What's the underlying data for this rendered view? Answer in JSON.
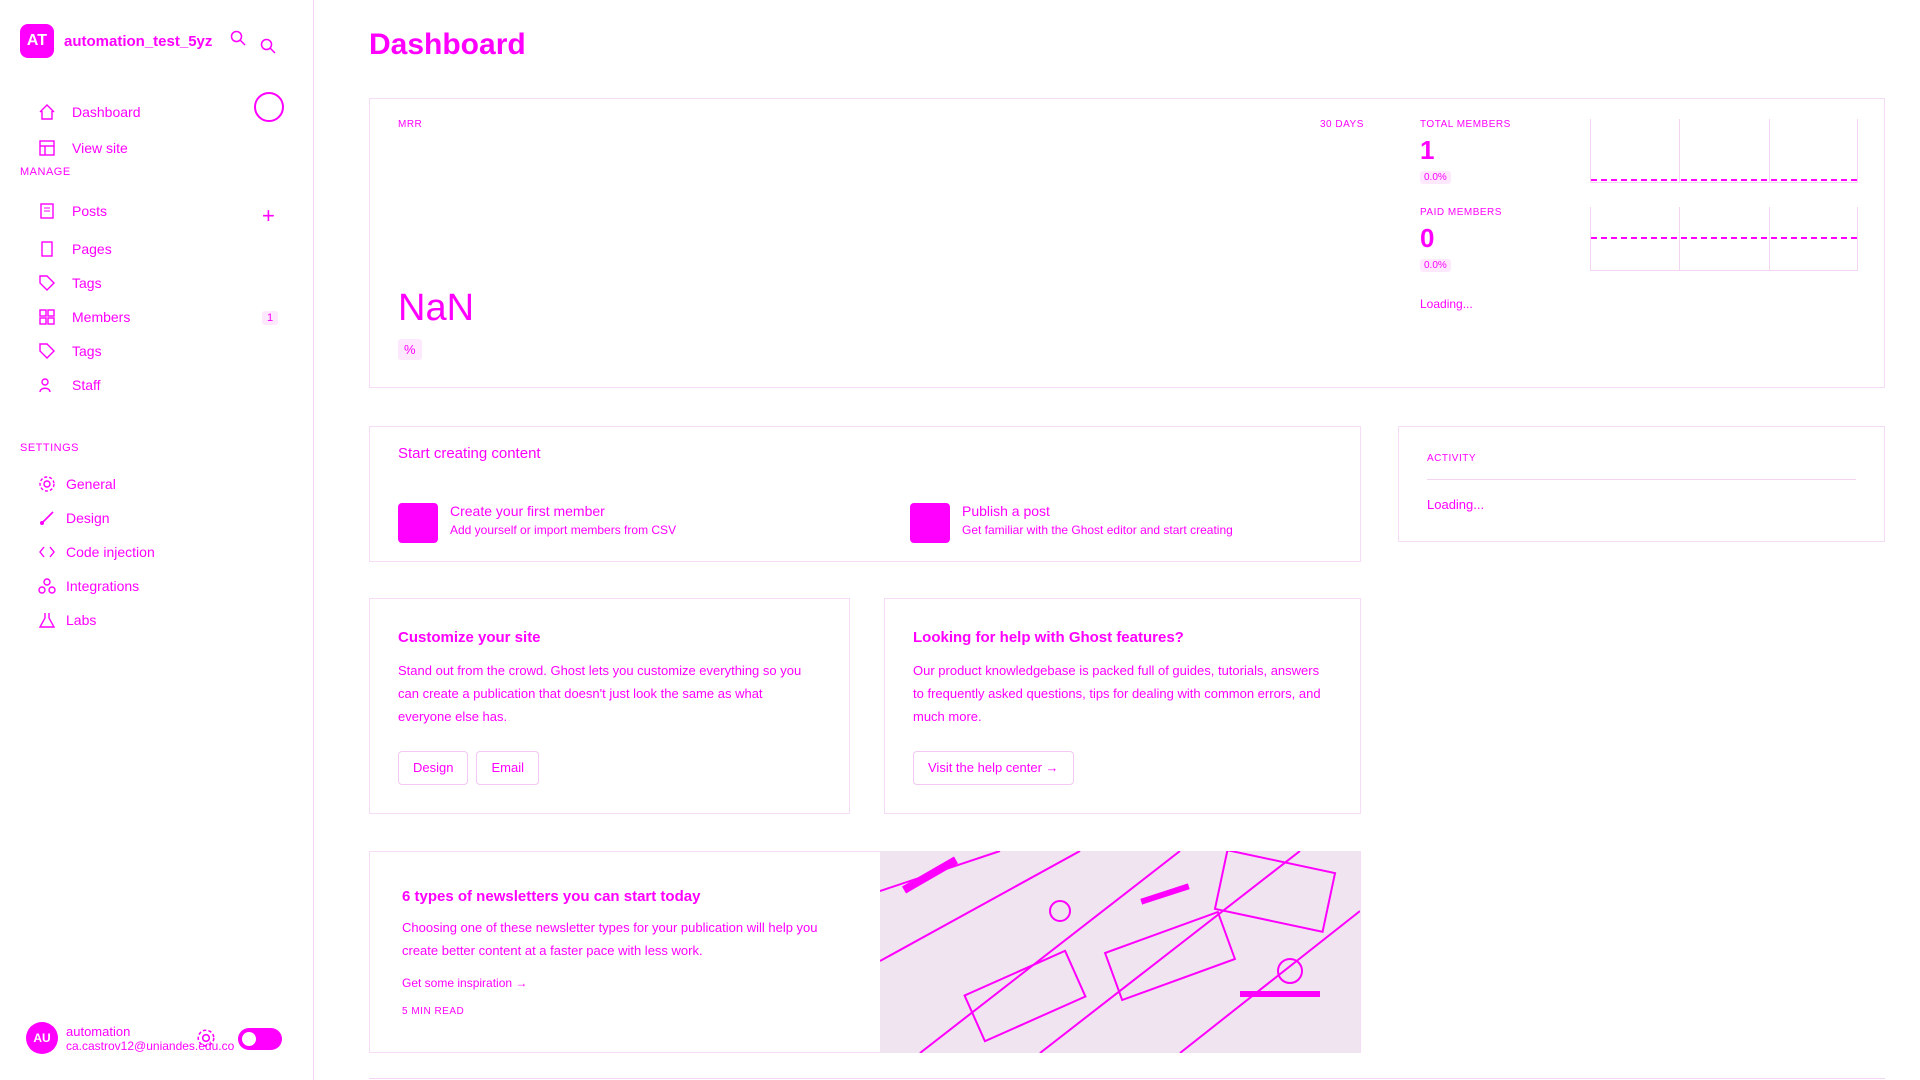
{
  "brand": {
    "name": "automation_test_5yz",
    "initials": "AT"
  },
  "sidebar": {
    "top_items": [
      {
        "label": "Dashboard",
        "icon": "home-icon"
      },
      {
        "label": "View site",
        "icon": "layout-icon"
      }
    ],
    "manage_label": "MANAGE",
    "manage_items": [
      {
        "label": "Posts",
        "icon": "posts-icon"
      },
      {
        "label": "Pages",
        "icon": "pages-icon"
      },
      {
        "label": "Tags",
        "icon": "tag-icon"
      },
      {
        "label": "Members",
        "icon": "members-icon",
        "count": "1"
      },
      {
        "label": "Tags",
        "icon": "tag-icon"
      },
      {
        "label": "Staff",
        "icon": "staff-icon"
      }
    ],
    "settings_label": "SETTINGS",
    "settings_items": [
      {
        "label": "General",
        "icon": "gear-icon"
      },
      {
        "label": "Design",
        "icon": "brush-icon"
      },
      {
        "label": "Code injection",
        "icon": "code-icon"
      },
      {
        "label": "Integrations",
        "icon": "integrations-icon"
      },
      {
        "label": "Labs",
        "icon": "flask-icon"
      }
    ],
    "user": {
      "name": "automation",
      "email": "ca.castrov12@uniandes.edu.co",
      "initials": "AU"
    }
  },
  "main": {
    "title": "Dashboard",
    "mrr": {
      "label": "MRR",
      "range": "30 DAYS",
      "value": "NaN",
      "pct": "%"
    },
    "total_members": {
      "label": "TOTAL MEMBERS",
      "value": "1",
      "pct": "0.0%"
    },
    "paid_members": {
      "label": "PAID MEMBERS",
      "value": "0",
      "pct": "0.0%"
    },
    "members_loading": "Loading...",
    "start_card": {
      "title": "Start creating content",
      "features": [
        {
          "title": "Create your first member",
          "sub": "Add yourself or import members from CSV"
        },
        {
          "title": "Publish a post",
          "sub": "Get familiar with the Ghost editor and start creating"
        }
      ]
    },
    "activity": {
      "label": "ACTIVITY",
      "loading": "Loading..."
    },
    "customize": {
      "title": "Customize your site",
      "body": "Stand out from the crowd. Ghost lets you customize everything so you can create a publication that doesn't just look the same as what everyone else has.",
      "buttons": [
        "Design",
        "Email"
      ]
    },
    "help": {
      "title": "Looking for help with Ghost features?",
      "body": "Our product knowledgebase is packed full of guides, tutorials, answers to frequently asked questions, tips for dealing with common errors, and much more.",
      "button": "Visit the help center →"
    },
    "newsletter": {
      "title": "6 types of newsletters you can start today",
      "body": "Choosing one of these newsletter types for your publication will help you create better content at a faster pace with less work.",
      "link": "Get some inspiration →",
      "read_time": "5 MIN READ"
    }
  },
  "colors": {
    "accent": "#ff00ff",
    "border": "#f3d4f3"
  }
}
